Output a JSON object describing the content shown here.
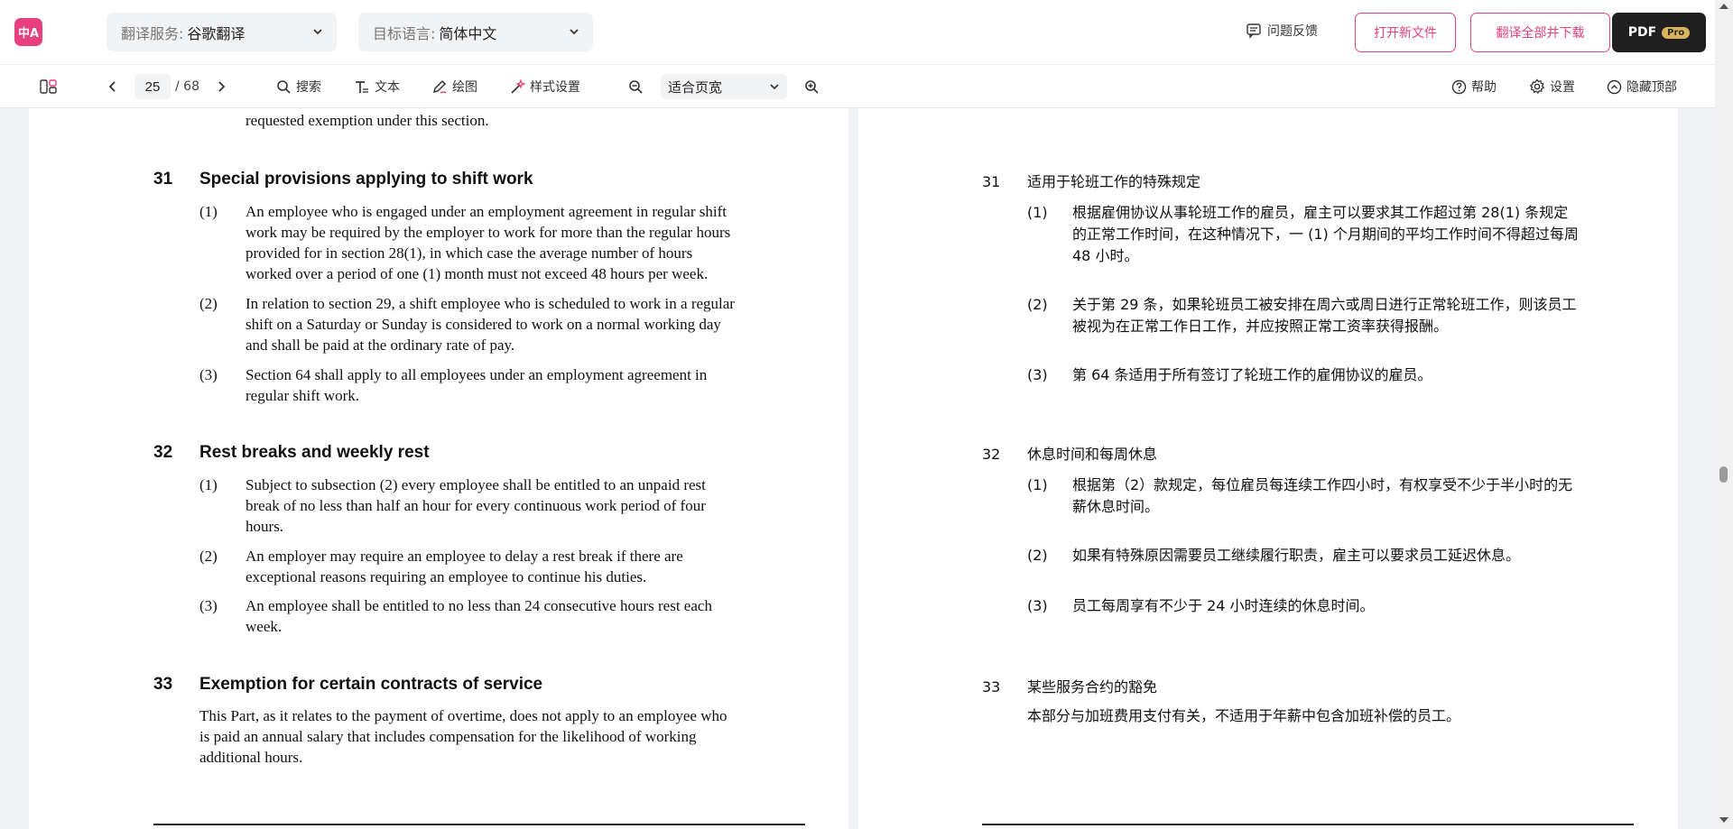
{
  "topbar": {
    "logo_text": "中A",
    "service": {
      "label": "翻译服务:",
      "value": "谷歌翻译"
    },
    "language": {
      "label": "目标语言:",
      "value": "简体中文"
    },
    "feedback_label": "问题反馈",
    "open_file_label": "打开新文件",
    "translate_all_label": "翻译全部并下载",
    "pdf_label": "PDF",
    "pro_badge": "Pro",
    "accent_color": "#e8407e"
  },
  "toolbar": {
    "page_current": "25",
    "page_total": "/ 68",
    "search_label": "搜索",
    "text_label": "文本",
    "draw_label": "绘图",
    "style_label": "样式设置",
    "zoom_value": "适合页宽",
    "help_label": "帮助",
    "settings_label": "设置",
    "hide_top_label": "隐藏顶部"
  },
  "source": {
    "top_fragment": "requested exemption under this section.",
    "sections": [
      {
        "number": "31",
        "title": "Special provisions applying to shift work",
        "items": [
          {
            "num": "(1)",
            "lines": [
              "An employee who is engaged under an employment agreement in regular shift",
              "work may be required by the employer to work for more than the regular hours",
              "provided for in section 28(1), in which case the average number of hours",
              "worked over a period of one (1) month must not exceed 48 hours per week."
            ]
          },
          {
            "num": "(2)",
            "lines": [
              "In relation to section 29, a shift employee who is scheduled to work in a regular",
              "shift on a Saturday or Sunday is considered to work on a normal working day",
              "and shall be paid at the ordinary rate of pay."
            ]
          },
          {
            "num": "(3)",
            "lines": [
              "Section 64 shall apply to all employees under an employment agreement in",
              "regular shift work."
            ]
          }
        ]
      },
      {
        "number": "32",
        "title": "Rest breaks and weekly rest",
        "items": [
          {
            "num": "(1)",
            "lines": [
              "Subject to subsection (2) every employee shall be entitled to an unpaid rest",
              "break of no less than half an hour for every continuous work period of four",
              "hours."
            ]
          },
          {
            "num": "(2)",
            "lines": [
              "An employer may require an employee to delay a rest break if there are",
              "exceptional reasons requiring an employee to continue his duties."
            ]
          },
          {
            "num": "(3)",
            "lines": [
              "An employee shall be entitled to no less than 24 consecutive hours rest each",
              "week."
            ]
          }
        ]
      },
      {
        "number": "33",
        "title": "Exemption for certain contracts of service",
        "body_lines": [
          "This Part, as it relates to the payment of overtime, does not apply to an employee who",
          "is paid an annual salary that includes compensation for the likelihood of working",
          "additional hours."
        ]
      }
    ]
  },
  "translation": {
    "sections": [
      {
        "number": "31",
        "title": "适用于轮班工作的特殊规定",
        "items": [
          {
            "num": "(1)",
            "lines": [
              "根据雇佣协议从事轮班工作的雇员，雇主可以要求其工作超过第 28(1) 条规定",
              "的正常工作时间，在这种情况下，一 (1) 个月期间的平均工作时间不得超过每周",
              "48 小时。"
            ]
          },
          {
            "num": "(2)",
            "lines": [
              "关于第 29 条，如果轮班员工被安排在周六或周日进行正常轮班工作，则该员工",
              "被视为在正常工作日工作，并应按照正常工资率获得报酬。"
            ]
          },
          {
            "num": "(3)",
            "lines": [
              "第 64 条适用于所有签订了轮班工作的雇佣协议的雇员。"
            ]
          }
        ]
      },
      {
        "number": "32",
        "title": "休息时间和每周休息",
        "items": [
          {
            "num": "(1)",
            "lines": [
              "根据第（2）款规定，每位雇员每连续工作四小时，有权享受不少于半小时的无",
              "薪休息时间。"
            ]
          },
          {
            "num": "(2)",
            "lines": [
              "如果有特殊原因需要员工继续履行职责，雇主可以要求员工延迟休息。"
            ]
          },
          {
            "num": "(3)",
            "lines": [
              "员工每周享有不少于 24 小时连续的休息时间。"
            ]
          }
        ]
      },
      {
        "number": "33",
        "title": "某些服务合约的豁免",
        "body_lines": [
          "本部分与加班费用支付有关，不适用于年薪中包含加班补偿的员工。"
        ]
      }
    ]
  }
}
